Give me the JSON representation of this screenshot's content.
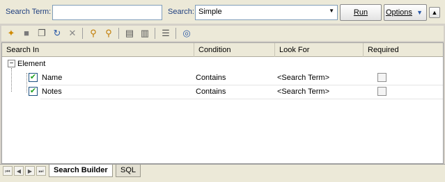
{
  "search": {
    "term_label": "Search Term:",
    "term_value": "",
    "search_label": "Search:",
    "search_value": "Simple",
    "run_label": "Run",
    "options_label": "Options"
  },
  "toolbar": {
    "icons": [
      "new-search-icon",
      "save-icon",
      "copy-icon",
      "refresh-icon",
      "delete-icon",
      "add-filter-icon",
      "remove-filter-icon",
      "new-row-icon",
      "insert-row-icon",
      "check-list-icon",
      "help-icon"
    ]
  },
  "grid": {
    "columns": [
      "Search In",
      "Condition",
      "Look For",
      "Required"
    ],
    "group": {
      "label": "Element",
      "expander": "−"
    },
    "rows": [
      {
        "search_in": "Name",
        "checked": true,
        "condition": "Contains",
        "look_for": "<Search Term>",
        "required": false
      },
      {
        "search_in": "Notes",
        "checked": true,
        "condition": "Contains",
        "look_for": "<Search Term>",
        "required": false
      }
    ]
  },
  "tabs": [
    "Search Builder",
    "SQL"
  ],
  "colors": {
    "label": "#1f3f7f",
    "check": "#21a121"
  }
}
